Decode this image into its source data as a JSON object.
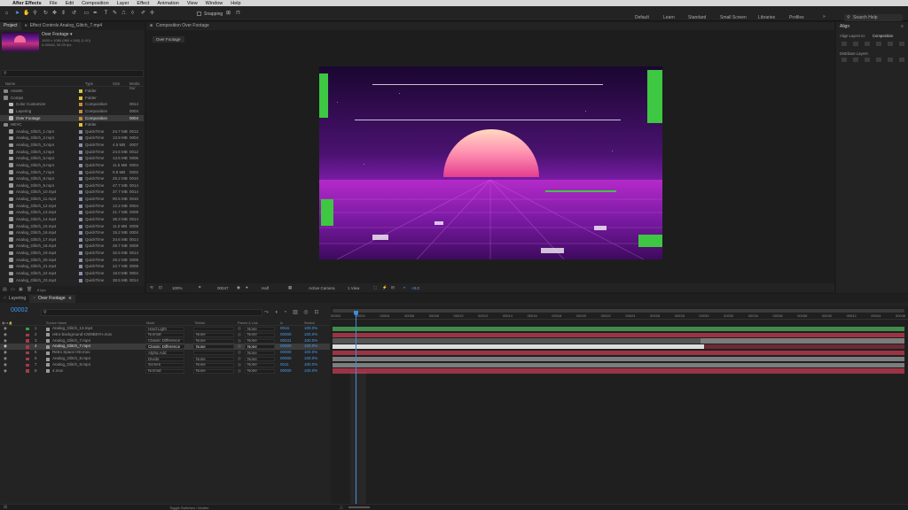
{
  "menu": {
    "apple": "",
    "app": "After Effects",
    "items": [
      "File",
      "Edit",
      "Composition",
      "Layer",
      "Effect",
      "Animation",
      "View",
      "Window",
      "Help"
    ]
  },
  "toolbar": {
    "snapping": "Snapping",
    "workspaces": [
      "Default",
      "Learn",
      "Standard",
      "Small Screen",
      "Libraries",
      "Profiles"
    ],
    "search_help": "Search Help"
  },
  "project": {
    "tab_project": "Project",
    "tab_effect": "Effect Controls Analog_Glitch_7.mp4",
    "preview_name": "Over Footage ▾",
    "preview_info1": "1920 x 1080 (960 x 540) (1.00)",
    "preview_info2": "Δ 00046, 30.00 fps",
    "search_placeholder": "",
    "col_name": "Name",
    "col_type": "Type",
    "col_size": "Size",
    "col_frame": "Media Dur",
    "items": [
      {
        "name": "Assets",
        "type": "Folder",
        "size": "",
        "dur": "",
        "kind": "folder",
        "indent": 0,
        "color": "#d9c33e"
      },
      {
        "name": "Comps",
        "type": "Folder",
        "size": "",
        "dur": "",
        "kind": "folder",
        "indent": 0,
        "color": "#d9c33e"
      },
      {
        "name": "Color Customize",
        "type": "Composition",
        "size": "",
        "dur": "0014",
        "kind": "comp",
        "indent": 1,
        "color": "#c88a3b"
      },
      {
        "name": "Layering",
        "type": "Composition",
        "size": "",
        "dur": "0004",
        "kind": "comp",
        "indent": 1,
        "color": "#c88a3b"
      },
      {
        "name": "Over Footage",
        "type": "Composition",
        "size": "",
        "dur": "0004",
        "kind": "comp",
        "indent": 1,
        "color": "#c88a3b"
      },
      {
        "name": "HEVC",
        "type": "Folder",
        "size": "",
        "dur": "",
        "kind": "folder",
        "indent": 0,
        "color": "#d9c33e"
      },
      {
        "name": "Analog_Glitch_1.mp4",
        "type": "QuickTime",
        "size": "24.7 MB",
        "dur": "0012",
        "kind": "file",
        "indent": 1,
        "color": "#8a8fa8"
      },
      {
        "name": "Analog_Glitch_2.mp4",
        "type": "QuickTime",
        "size": "13.9 MB",
        "dur": "0004",
        "kind": "file",
        "indent": 1,
        "color": "#8a8fa8"
      },
      {
        "name": "Analog_Glitch_3.mp4",
        "type": "QuickTime",
        "size": "4.5 MB",
        "dur": "0007",
        "kind": "file",
        "indent": 1,
        "color": "#8a8fa8"
      },
      {
        "name": "Analog_Glitch_4.mp4",
        "type": "QuickTime",
        "size": "24.5 MB",
        "dur": "0012",
        "kind": "file",
        "indent": 1,
        "color": "#8a8fa8"
      },
      {
        "name": "Analog_Glitch_5.mp4",
        "type": "QuickTime",
        "size": "13.5 MB",
        "dur": "0006",
        "kind": "file",
        "indent": 1,
        "color": "#8a8fa8"
      },
      {
        "name": "Analog_Glitch_6.mp4",
        "type": "QuickTime",
        "size": "11.5 MB",
        "dur": "0004",
        "kind": "file",
        "indent": 1,
        "color": "#8a8fa8"
      },
      {
        "name": "Analog_Glitch_7.mp4",
        "type": "QuickTime",
        "size": "9.9 MB",
        "dur": "0002",
        "kind": "file",
        "indent": 1,
        "color": "#8a8fa8"
      },
      {
        "name": "Analog_Glitch_8.mp4",
        "type": "QuickTime",
        "size": "25.2 MB",
        "dur": "0010",
        "kind": "file",
        "indent": 1,
        "color": "#8a8fa8"
      },
      {
        "name": "Analog_Glitch_9.mp4",
        "type": "QuickTime",
        "size": "47.7 MB",
        "dur": "0014",
        "kind": "file",
        "indent": 1,
        "color": "#8a8fa8"
      },
      {
        "name": "Analog_Glitch_10.mp4",
        "type": "QuickTime",
        "size": "37.7 MB",
        "dur": "0014",
        "kind": "file",
        "indent": 1,
        "color": "#8a8fa8"
      },
      {
        "name": "Analog_Glitch_11.mp4",
        "type": "QuickTime",
        "size": "90.5 MB",
        "dur": "0010",
        "kind": "file",
        "indent": 1,
        "color": "#8a8fa8"
      },
      {
        "name": "Analog_Glitch_12.mp4",
        "type": "QuickTime",
        "size": "12.2 MB",
        "dur": "0004",
        "kind": "file",
        "indent": 1,
        "color": "#8a8fa8"
      },
      {
        "name": "Analog_Glitch_13.mp4",
        "type": "QuickTime",
        "size": "21.7 MB",
        "dur": "0009",
        "kind": "file",
        "indent": 1,
        "color": "#8a8fa8"
      },
      {
        "name": "Analog_Glitch_14.mp4",
        "type": "QuickTime",
        "size": "38.3 MB",
        "dur": "0014",
        "kind": "file",
        "indent": 1,
        "color": "#8a8fa8"
      },
      {
        "name": "Analog_Glitch_15.mp4",
        "type": "QuickTime",
        "size": "11.0 MB",
        "dur": "0008",
        "kind": "file",
        "indent": 1,
        "color": "#8a8fa8"
      },
      {
        "name": "Analog_Glitch_16.mp4",
        "type": "QuickTime",
        "size": "15.2 MB",
        "dur": "0004",
        "kind": "file",
        "indent": 1,
        "color": "#8a8fa8"
      },
      {
        "name": "Analog_Glitch_17.mp4",
        "type": "QuickTime",
        "size": "34.6 MB",
        "dur": "0014",
        "kind": "file",
        "indent": 1,
        "color": "#8a8fa8"
      },
      {
        "name": "Analog_Glitch_18.mp4",
        "type": "QuickTime",
        "size": "29.7 MB",
        "dur": "0009",
        "kind": "file",
        "indent": 1,
        "color": "#8a8fa8"
      },
      {
        "name": "Analog_Glitch_19.mp4",
        "type": "QuickTime",
        "size": "32.5 MB",
        "dur": "0014",
        "kind": "file",
        "indent": 1,
        "color": "#8a8fa8"
      },
      {
        "name": "Analog_Glitch_20.mp4",
        "type": "QuickTime",
        "size": "29.2 MB",
        "dur": "0009",
        "kind": "file",
        "indent": 1,
        "color": "#8a8fa8"
      },
      {
        "name": "Analog_Glitch_21.mp4",
        "type": "QuickTime",
        "size": "22.7 MB",
        "dur": "0009",
        "kind": "file",
        "indent": 1,
        "color": "#8a8fa8"
      },
      {
        "name": "Analog_Glitch_22.mp4",
        "type": "QuickTime",
        "size": "18.0 MB",
        "dur": "0004",
        "kind": "file",
        "indent": 1,
        "color": "#8a8fa8"
      },
      {
        "name": "Analog_Glitch_23.mp4",
        "type": "QuickTime",
        "size": "38.5 MB",
        "dur": "0014",
        "kind": "file",
        "indent": 1,
        "color": "#8a8fa8"
      }
    ],
    "bottom_bpc": "8 bpc"
  },
  "composition": {
    "tab": "Composition Over Footage",
    "subtab": "Over Footage",
    "zoom": "100%",
    "timecode": "00047",
    "resolution": "Half",
    "camera": "Active Camera",
    "view": "1 View",
    "exposure": "+0.0"
  },
  "align": {
    "title": "Align",
    "align_to_label": "Align Layers to:",
    "align_to_value": "Composition",
    "distribute_label": "Distribute Layers:"
  },
  "timeline": {
    "tab_layering": "Layering",
    "tab_over": "Over Footage",
    "timecode": "00002",
    "search_placeholder": "",
    "col_layer": "Source Name",
    "col_mode": "Mode",
    "col_trkmat": "TrkMat",
    "col_parent": "Parent & Link",
    "col_in": "In",
    "col_stretch": "Stretch",
    "ruler": [
      "00000",
      "00002",
      "00004",
      "00006",
      "00008",
      "00010",
      "00012",
      "00014",
      "00016",
      "00018",
      "00020",
      "00022",
      "00024",
      "00026",
      "00028",
      "00030",
      "00032",
      "00034",
      "00036",
      "00038",
      "00040",
      "00042",
      "00044",
      "00046"
    ],
    "layers": [
      {
        "num": "1",
        "name": "Analog_Glitch_13.mp4",
        "mode": "Hard Light",
        "trkmat": "",
        "parent": "None",
        "in": "0016",
        "stretch": "100.0%",
        "color": "#2f9e4a"
      },
      {
        "num": "2",
        "name": "retro-background-CW9B0YH.mov",
        "mode": "Normal",
        "trkmat": "None",
        "parent": "None",
        "in": "00000",
        "stretch": "100.0%",
        "color": "#a63a49"
      },
      {
        "num": "3",
        "name": "Analog_Glitch_7.mp4",
        "mode": "Classic Difference",
        "trkmat": "None",
        "parent": "None",
        "in": "00031",
        "stretch": "100.0%",
        "color": "#a63a49"
      },
      {
        "num": "4",
        "name": "Analog_Glitch_7.mp4",
        "mode": "Classic Difference",
        "trkmat": "None",
        "parent": "None",
        "in": "00000",
        "stretch": "100.0%",
        "color": "#a63a49"
      },
      {
        "num": "5",
        "name": "Retro Space HD.mov",
        "mode": "Alpha Add",
        "trkmat": "",
        "parent": "None",
        "in": "00000",
        "stretch": "100.0%",
        "color": "#a63a49"
      },
      {
        "num": "6",
        "name": "Analog_Glitch_8.mp4",
        "mode": "Divide",
        "trkmat": "None",
        "parent": "None",
        "in": "00000",
        "stretch": "100.0%",
        "color": "#a63a49"
      },
      {
        "num": "7",
        "name": "Analog_Glitch_9.mp4",
        "mode": "Screen",
        "trkmat": "None",
        "parent": "None",
        "in": "0011",
        "stretch": "100.0%",
        "color": "#a63a49"
      },
      {
        "num": "8",
        "name": "4.mov",
        "mode": "Normal",
        "trkmat": "None",
        "parent": "None",
        "in": "00000",
        "stretch": "100.0%",
        "color": "#a63a49"
      }
    ],
    "toggle_label": "Toggle Switches / Modes"
  },
  "colors": {
    "accent": "#2d8ceb",
    "comp_bg": "#1d1d1d",
    "bar_grey": "#7c7c7c",
    "bar_red": "#9a3445",
    "bar_green": "#3f8c4c"
  }
}
